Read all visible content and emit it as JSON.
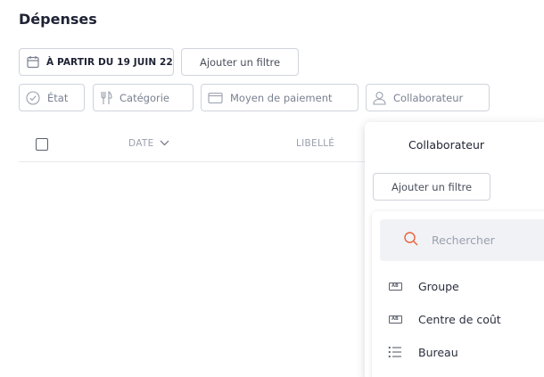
{
  "page": {
    "title": "Dépenses"
  },
  "filters": {
    "date_chip": "À PARTIR DU 19 JUIN 22",
    "add_filter": "Ajouter un filtre",
    "etat": "État",
    "categorie": "Catégorie",
    "moyen_paiement": "Moyen de paiement",
    "collaborateur": "Collaborateur"
  },
  "table": {
    "columns": {
      "date": "DATE",
      "libelle": "LIBELLÉ"
    }
  },
  "dropdown": {
    "title": "Collaborateur",
    "add_filter": "Ajouter un filtre",
    "search_placeholder": "Rechercher",
    "options": [
      {
        "label": "Groupe",
        "icon": "tag-icon"
      },
      {
        "label": "Centre de coût",
        "icon": "tag-icon"
      },
      {
        "label": "Bureau",
        "icon": "list-icon"
      }
    ],
    "accent_color": "#e8643c"
  }
}
